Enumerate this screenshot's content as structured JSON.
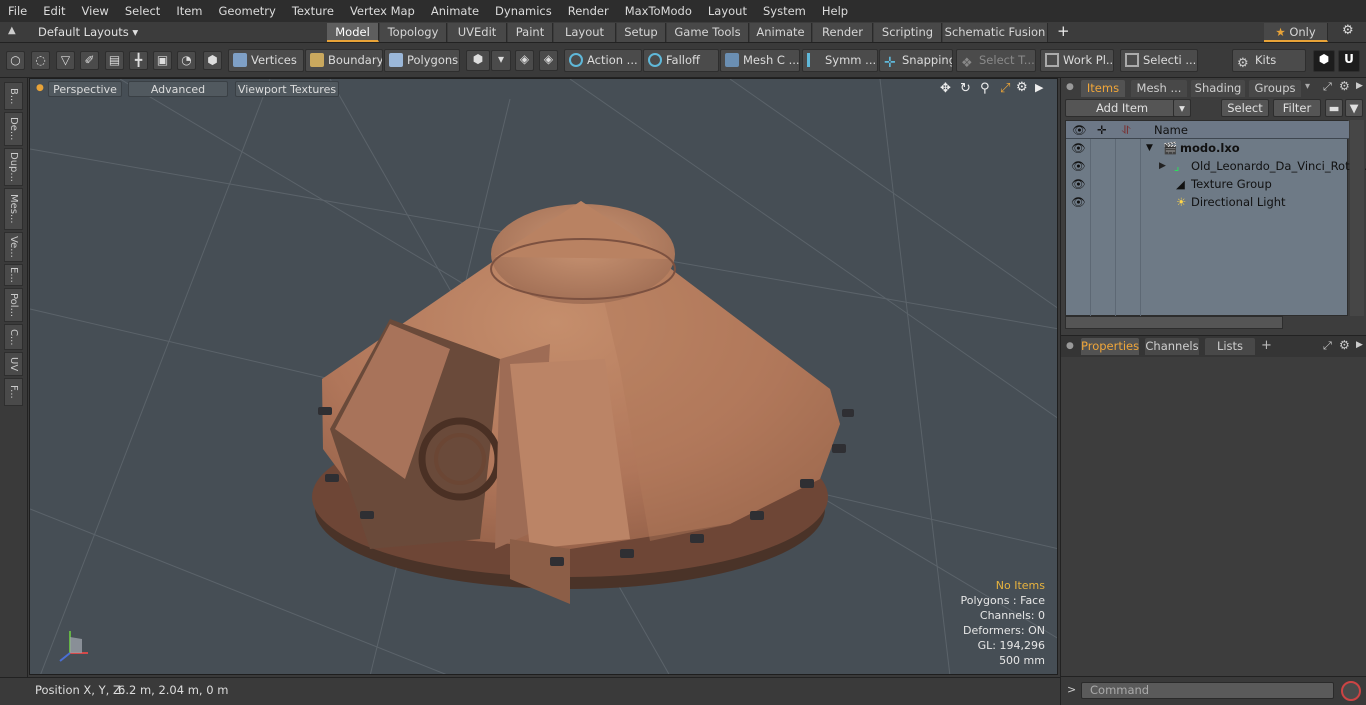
{
  "menu": [
    "File",
    "Edit",
    "View",
    "Select",
    "Item",
    "Geometry",
    "Texture",
    "Vertex Map",
    "Animate",
    "Dynamics",
    "Render",
    "MaxToModo",
    "Layout",
    "System",
    "Help"
  ],
  "layout_selector": "Default Layouts",
  "layout_tabs": [
    "Model",
    "Topology",
    "UVEdit",
    "Paint",
    "Layout",
    "Setup",
    "Game Tools",
    "Animate",
    "Render",
    "Scripting",
    "Schematic Fusion"
  ],
  "active_layout_tab": "Model",
  "only_label": "Only",
  "toolbar": {
    "vertices": "Vertices",
    "boundary": "Boundary",
    "polygons": "Polygons",
    "action": "Action ...",
    "falloff": "Falloff",
    "mesh": "Mesh C ...",
    "symm": "Symm ...",
    "snapping": "Snapping",
    "select_t": "Select T...",
    "work_pl": "Work Pl...",
    "selecti": "Selecti ...",
    "kits": "Kits"
  },
  "left_tabs": [
    "B...",
    "De...",
    "Dup...",
    "Mes...",
    "Ve...",
    "E...",
    "Pol...",
    "C...",
    "UV",
    "F..."
  ],
  "viewport": {
    "perspective": "Perspective",
    "advanced": "Advanced",
    "viewport_textures": "Viewport Textures",
    "stats": {
      "no_items": "No Items",
      "polygons": "Polygons : Face",
      "channels": "Channels: 0",
      "deformers": "Deformers: ON",
      "gl": "GL: 194,296",
      "scale": "500 mm"
    }
  },
  "status": {
    "position_label": "Position X, Y, Z:",
    "position_value": "6.2 m, 2.04 m, 0 m"
  },
  "panel_tabs": [
    "Items",
    "Mesh ...",
    "Shading",
    "Groups"
  ],
  "items_panel": {
    "add_item": "Add Item",
    "select": "Select",
    "filter": "Filter",
    "name_header": "Name",
    "rows": [
      {
        "label": "modo.lxo",
        "bold": true
      },
      {
        "label": "Old_Leonardo_Da_Vinci_Rota..."
      },
      {
        "label": "Texture Group"
      },
      {
        "label": "Directional Light"
      }
    ]
  },
  "bottom_tabs": [
    "Properties",
    "Channels",
    "Lists"
  ],
  "command_placeholder": "Command",
  "colors": {
    "accent": "#e8a338",
    "viewport_bg": "#464e55",
    "item_table": "#6e7a86"
  }
}
